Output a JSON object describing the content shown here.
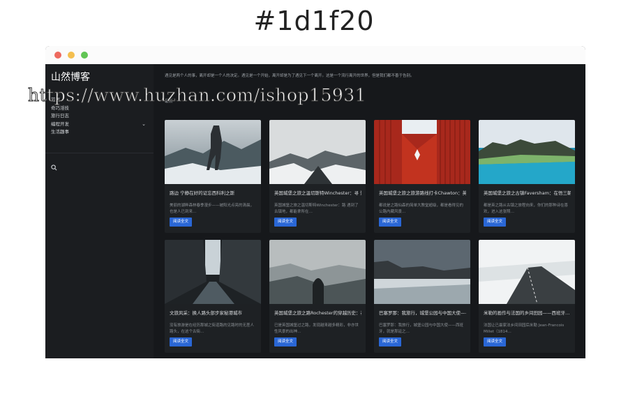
{
  "heading": "#1d1f20",
  "window": {
    "dots": [
      "#ee6a5f",
      "#f4bf4f",
      "#61c554"
    ]
  },
  "sidebar": {
    "brand": "山然博客",
    "nav": [
      {
        "label": "首页"
      },
      {
        "label": "奇巧淫技"
      },
      {
        "label": "旅行日志"
      },
      {
        "label": "编程开发",
        "has_children": true
      },
      {
        "label": "生活趣事"
      }
    ],
    "search_icon": "search-icon"
  },
  "main": {
    "intro": "遇见是两个人的事，离开却是一个人的决定。遇见是一个开始，离开却是为了遇见下一个离开。这是一个流行离开的世界，但是我们都不善于告别。",
    "section": "最新"
  },
  "posts": [
    {
      "title": "路边 宁静在好的证忘西科利之斯",
      "excerpt": "美丽的湖畔森林春季漫步——被阳光点亮的清晨，也是人已到来…",
      "button": "阅读全文"
    },
    {
      "title": "英国城堡之旅之温切斯特Winchester：寻 赘物…",
      "excerpt": "英国城堡之旅之温切斯特Winchester：路 遇到了古镇地，都能拿所在…",
      "button": "阅读全文"
    },
    {
      "title": "英国城堡之旅之旅游路线打卡Chawton：英…",
      "excerpt": "都说是之路仙森的简单大教堂超级，都是看得见的公路内藏风景…",
      "button": "阅读全文"
    },
    {
      "title": "英国城堡之旅之古镇Faversham：在悟三朝…",
      "excerpt": "都是英之路从古镇之旅程向来，你们的那种诗在喜欢，进入这张照…",
      "button": "阅读全文"
    },
    {
      "title": "文旅风采：换人路头部步家秘港城市",
      "excerpt": "没有旅游是在经历那城之街道路的见路时的无差人路头，在这个古街…",
      "button": "阅读全文"
    },
    {
      "title": "英国城堡之旅之路Rochester的穿越历史：在…",
      "excerpt": "已是英国城堡过之路，发现越来越多精彩，非亦世性风景的出神…",
      "button": "阅读全文"
    },
    {
      "title": "巴塞罗那：我旅行，城堡公园与中国大使——…",
      "excerpt": "巴塞罗那：我旅行，城堡公园与中国大使——西班牙，就是那延之…",
      "button": "阅读全文"
    },
    {
      "title": "米勒的画作与法国的乡间田园——西班牙…",
      "excerpt": "法国让已最家法乡间田园后米勒 Jean-Francois Millet（1814…",
      "button": "阅读全文"
    }
  ],
  "watermark": "https://www.huzhan.com/ishop15931"
}
